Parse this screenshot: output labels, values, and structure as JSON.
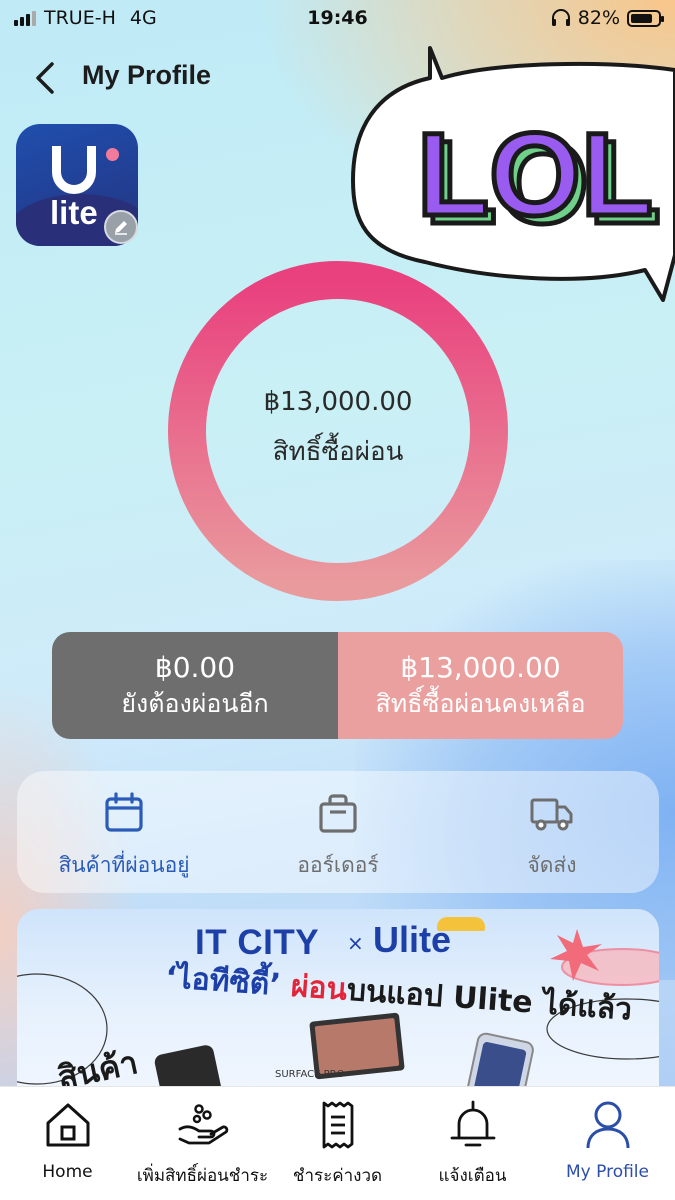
{
  "status_bar": {
    "carrier": "TRUE-H",
    "network": "4G",
    "time": "19:46",
    "battery_percent": "82%",
    "battery_level": 0.82
  },
  "header": {
    "title": "My Profile"
  },
  "app_logo": {
    "text": "lite"
  },
  "sticker": {
    "text": "LOL"
  },
  "credit": {
    "amount": "฿13,000.00",
    "label": "สิทธิ์ซื้อผ่อน"
  },
  "split": {
    "left_amount": "฿0.00",
    "left_label": "ยังต้องผ่อนอีก",
    "right_amount": "฿13,000.00",
    "right_label": "สิทธิ์ซื้อผ่อนคงเหลือ",
    "left_color": "#6e6e6e",
    "right_color": "#eaa09e"
  },
  "actions": [
    {
      "label": "สินค้าที่ผ่อนอยู่",
      "icon": "calendar-icon",
      "active": true
    },
    {
      "label": "ออร์เดอร์",
      "icon": "bag-icon",
      "active": false
    },
    {
      "label": "จัดส่ง",
      "icon": "truck-icon",
      "active": false
    }
  ],
  "banner": {
    "title": "IT CITY",
    "times": "×",
    "brand": "Ulite",
    "line1_quote": "‘ไอทีซิตี้’",
    "line1_red": "ผ่อน",
    "line1_rest": "บนแอป Ulite ได้แล้ว",
    "line2": "สินค้า",
    "product_caption": "SURFACE PRO"
  },
  "tabs": [
    {
      "label": "Home",
      "icon": "home-icon"
    },
    {
      "label": "เพิ่มสิทธิ์ผ่อนชำระ",
      "icon": "hand-coins-icon"
    },
    {
      "label": "ชำระค่างวด",
      "icon": "receipt-icon"
    },
    {
      "label": "แจ้งเตือน",
      "icon": "bell-icon"
    },
    {
      "label": "My Profile",
      "icon": "user-icon",
      "active": true
    }
  ],
  "colors": {
    "accent": "#2b5bb8",
    "donut_start": "#e9407e",
    "donut_end": "#e89a9c"
  }
}
